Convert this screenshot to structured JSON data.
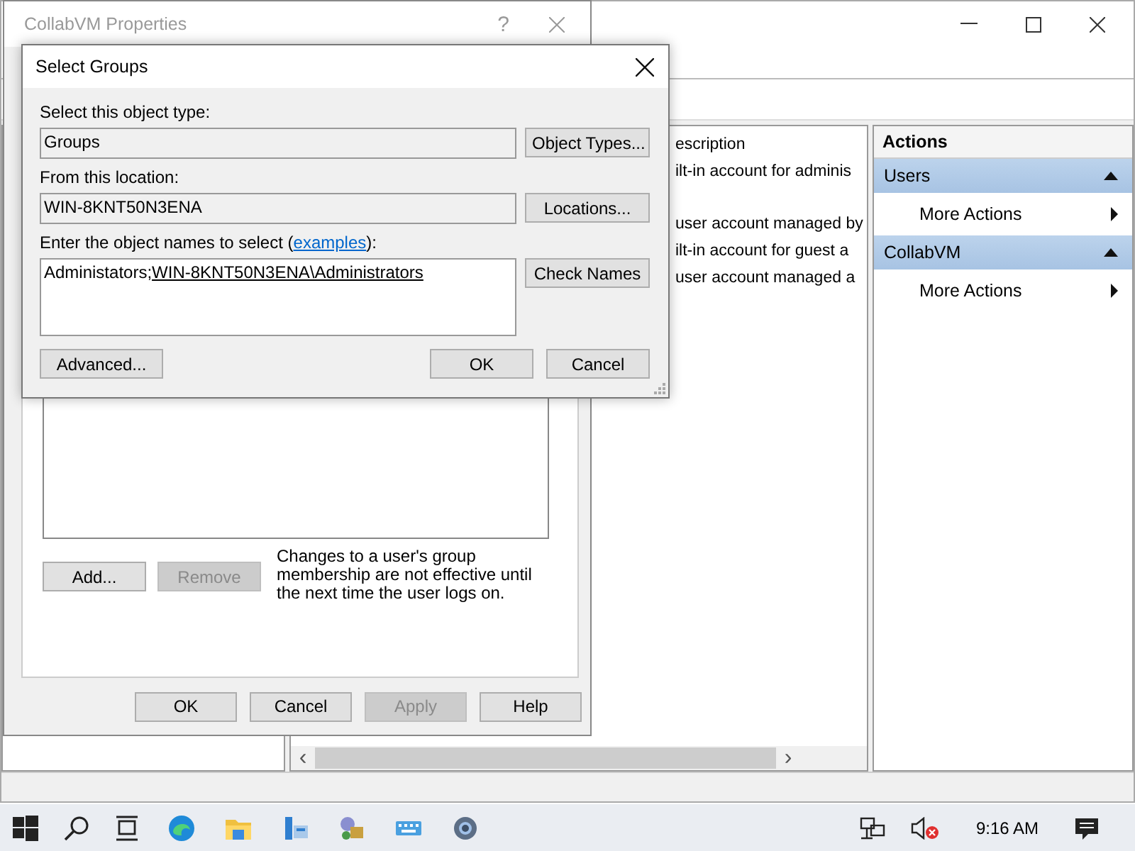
{
  "main_window": {
    "list_header": "escription",
    "scroll_left": "‹",
    "scroll_right": "›",
    "list_rows": [
      "ilt-in account for adminis",
      "user account managed by",
      "ilt-in account for guest a",
      "user account managed a"
    ],
    "actions": {
      "title": "Actions",
      "groups": [
        {
          "title": "Users",
          "expanded": true,
          "items": [
            "More Actions"
          ]
        },
        {
          "title": "CollabVM",
          "expanded": true,
          "items": [
            "More Actions"
          ]
        }
      ]
    }
  },
  "properties_dialog": {
    "title": "CollabVM Properties",
    "help_glyph": "?",
    "list_buttons": [
      {
        "label": "Add...",
        "disabled": false
      },
      {
        "label": "Remove",
        "disabled": true
      }
    ],
    "note": "Changes to a user's group membership are not effective until the next time the user logs on.",
    "footer_buttons": [
      {
        "label": "OK",
        "disabled": false
      },
      {
        "label": "Cancel",
        "disabled": false
      },
      {
        "label": "Apply",
        "disabled": true
      },
      {
        "label": "Help",
        "disabled": false
      }
    ]
  },
  "select_groups": {
    "title": "Select Groups",
    "object_type_label": "Select this object type:",
    "object_type": "Groups",
    "object_types_button": "Object Types...",
    "location_label": "From this location:",
    "location": "WIN-8KNT50N3ENA",
    "locations_button": "Locations...",
    "names_label_before": "Enter the object names to select (",
    "examples_link": "examples",
    "names_label_after": "):",
    "names_typed": "Administators;",
    "names_resolved": "WIN-8KNT50N3ENA\\Administrators",
    "check_names_button": "Check Names",
    "advanced_button": "Advanced...",
    "ok_button": "OK",
    "cancel_button": "Cancel"
  },
  "taskbar": {
    "volume_muted": true,
    "clock": "9:16 AM"
  }
}
